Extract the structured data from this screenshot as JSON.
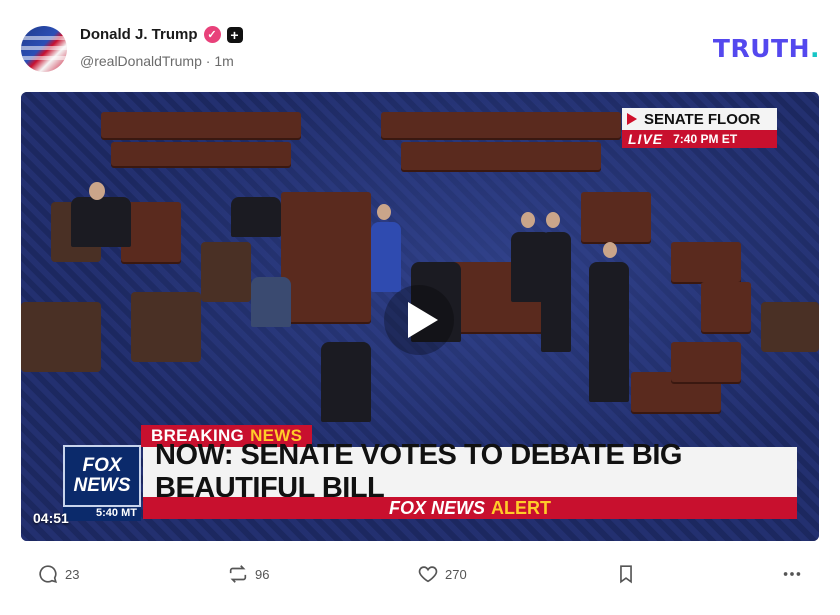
{
  "post": {
    "author_name": "Donald J. Trump",
    "verified_icon": "verified-check-icon",
    "plus_badge_icon": "plus-badge-icon",
    "handle": "@realDonaldTrump",
    "separator": "·",
    "time_ago": "1m"
  },
  "brand": {
    "logo_text": "TRUTH",
    "logo_dot": ".",
    "logo_color": "#5448ee",
    "dot_color": "#17c5c5"
  },
  "video": {
    "duration": "04:51",
    "play_icon": "play-icon",
    "overlay": {
      "bug_title": "SENATE FLOOR",
      "bug_live": "LIVE",
      "bug_time": "7:40 PM ET",
      "breaking_label": "BREAKING",
      "breaking_news": "NEWS",
      "network_line1": "FOX",
      "network_line2": "NEWS",
      "network_time": "5:40 MT",
      "headline": "NOW: SENATE VOTES TO DEBATE BIG BEAUTIFUL BILL",
      "alert_brand": "FOX NEWS",
      "alert_word": "ALERT"
    }
  },
  "actions": {
    "replies": "23",
    "retruths": "96",
    "likes": "270",
    "reply_icon": "reply-icon",
    "retruth_icon": "retruth-icon",
    "like_icon": "heart-icon",
    "bookmark_icon": "bookmark-icon",
    "more_icon": "more-icon"
  },
  "colors": {
    "verified": "#e8417a",
    "fox_red": "#c8102e",
    "fox_yellow": "#ffcc29",
    "fox_blue": "#0b2a6b"
  }
}
